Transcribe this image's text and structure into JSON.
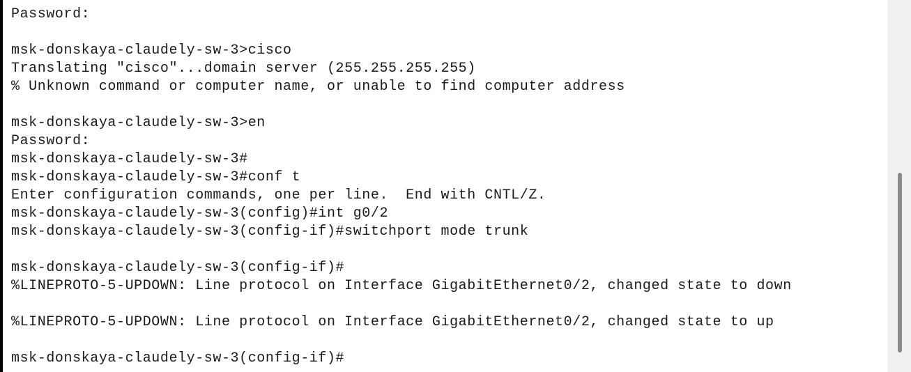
{
  "terminal": {
    "lines": [
      "Password:",
      "",
      "msk-donskaya-claudely-sw-3>cisco",
      "Translating \"cisco\"...domain server (255.255.255.255)",
      "% Unknown command or computer name, or unable to find computer address",
      "",
      "msk-donskaya-claudely-sw-3>en",
      "Password:",
      "msk-donskaya-claudely-sw-3#",
      "msk-donskaya-claudely-sw-3#conf t",
      "Enter configuration commands, one per line.  End with CNTL/Z.",
      "msk-donskaya-claudely-sw-3(config)#int g0/2",
      "msk-donskaya-claudely-sw-3(config-if)#switchport mode trunk",
      "",
      "msk-donskaya-claudely-sw-3(config-if)#",
      "%LINEPROTO-5-UPDOWN: Line protocol on Interface GigabitEthernet0/2, changed state to down",
      "",
      "%LINEPROTO-5-UPDOWN: Line protocol on Interface GigabitEthernet0/2, changed state to up",
      "",
      "msk-donskaya-claudely-sw-3(config-if)#"
    ]
  }
}
